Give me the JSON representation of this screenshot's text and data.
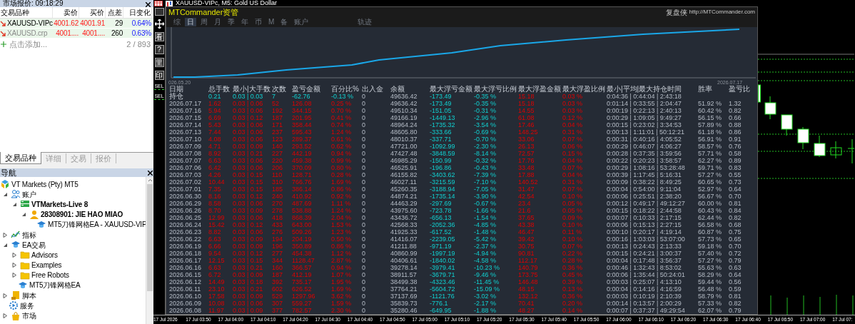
{
  "market_watch": {
    "title": "市场报价: 09:18:29",
    "columns": [
      "交易品种",
      "卖价",
      "买价",
      "点差",
      "日变化"
    ],
    "rows": [
      {
        "symbol": "XAUUSD-VIPc",
        "bid": "4001.62",
        "ask": "4001.91",
        "spread": "29",
        "change": "0.64%",
        "active": true
      },
      {
        "symbol": "XAUUSD.crp",
        "bid": "4001....",
        "ask": "4001....",
        "spread": "260",
        "change": "0.63%",
        "active": false
      }
    ],
    "add_label": "点击添加...",
    "count": "2 / 893",
    "tabs": [
      {
        "label": "交易品种",
        "selected": true
      },
      {
        "label": "详细",
        "selected": false
      },
      {
        "label": "交易",
        "selected": false
      },
      {
        "label": "报价",
        "selected": false
      }
    ]
  },
  "navigator": {
    "title": "导航",
    "items": [
      {
        "label": "VT Markets (Pty) MT5",
        "kind": "broker",
        "children": [
          {
            "label": "账户",
            "kind": "accounts",
            "expanded": true,
            "children": [
              {
                "label": "VTMarkets-Live 8",
                "kind": "server",
                "bold": true,
                "expanded": true,
                "children": [
                  {
                    "label": "28308901: JIE HAO MIAO",
                    "kind": "user",
                    "bold": true,
                    "expanded": true,
                    "children": [
                      {
                        "label": "MT5刀锋网格EA - XAUUSD-VIP",
                        "kind": "expert"
                      }
                    ]
                  }
                ]
              }
            ]
          },
          {
            "label": "指标",
            "kind": "indicators",
            "expanded": false
          },
          {
            "label": "EA交易",
            "kind": "expert",
            "expanded": true,
            "children": [
              {
                "label": "Advisors",
                "kind": "folder",
                "expanded": false
              },
              {
                "label": "Examples",
                "kind": "folder",
                "expanded": false
              },
              {
                "label": "Free Robots",
                "kind": "folder",
                "expanded": false
              },
              {
                "label": "MT5刀锋网格EA",
                "kind": "expert"
              }
            ]
          },
          {
            "label": "脚本",
            "kind": "script",
            "expanded": false
          },
          {
            "label": "服务",
            "kind": "service"
          },
          {
            "label": "市场",
            "kind": "market",
            "expanded": false
          }
        ]
      }
    ]
  },
  "chart_window": {
    "title": "XAUUSD-VIPc, M5:  Gold US Dollar",
    "toolbar": [
      {
        "kind": "minus"
      },
      {
        "kind": "move"
      },
      {
        "kind": "glyph",
        "label": "看"
      },
      {
        "kind": "glyph",
        "label": "?"
      },
      {
        "kind": "glyph",
        "label": "里"
      },
      {
        "kind": "glyph",
        "label": "印"
      }
    ],
    "order_labels": [
      "SEL",
      "SEL"
    ],
    "time_axis": [
      "17 Jul 2026",
      "17 Jul 03:50",
      "17 Jul 04:00",
      "17 Jul 04:10",
      "17 Jul 04:20",
      "17 Jul 04:30",
      "17 Jul 04:40",
      "17 Jul 04:50",
      "17 Jul 05:00",
      "17 Jul 05:10",
      "17 Jul 05:20",
      "17 Jul 05:30",
      "17 Jul 05:40",
      "17 Jul 05:50",
      "17 Jul 06:00",
      "17 Jul 06:10",
      "17 Jul 06:20",
      "17 Jul 06:30",
      "17 Jul 06:40",
      "17 Jul 06:50",
      "17 Jul 07:00",
      "17 Jul 07:"
    ]
  },
  "panel": {
    "title": "MTCommander资管",
    "brand": "复盘侠",
    "url": "http://MTCommander.com",
    "tabs": [
      {
        "label": "综",
        "selected": false
      },
      {
        "label": "日",
        "selected": true
      },
      {
        "label": "周",
        "selected": false
      },
      {
        "label": "月",
        "selected": false
      },
      {
        "label": "季",
        "selected": false
      },
      {
        "label": "年",
        "selected": false
      },
      {
        "label": "币",
        "selected": false
      },
      {
        "label": "M",
        "selected": false
      },
      {
        "label": "备",
        "selected": false
      },
      {
        "label": "账户",
        "selected": false
      },
      {
        "label": "轨迹",
        "selected": false
      }
    ],
    "equity_start": "026.05.20",
    "equity_end": "2026.07.17",
    "table": {
      "columns": [
        "日期",
        "总手数",
        "最小|大手数",
        "次数",
        "盈亏金额",
        "百分比%",
        "出入金",
        "余额",
        "最大浮亏金额",
        "最大浮亏比例",
        "最大浮盈金额",
        "最大浮盈比例",
        "最小|平均|最大持仓时间",
        "胜率",
        "盈亏比"
      ],
      "open_row": [
        "持仓",
        "0.21",
        "0.03 | 0.03",
        "7",
        "-62.76",
        "-0.13 %",
        "0",
        "49636.42",
        "-173.49",
        "-0.35 %",
        "15.18",
        "0.03 %",
        "0:04:36 | 0:44:04 | 2:43:18"
      ],
      "rows": [
        [
          "2026.07.17",
          "1.62",
          "0.03 | 0.06",
          "52",
          "126.08",
          "0.25 %",
          "0",
          "49636.42",
          "-173.49",
          "-0.35 %",
          "15.18",
          "0.03 %",
          "0:01:14 | 0:33:55 | 2:04:47",
          "51.92 %",
          "1.32"
        ],
        [
          "2026.07.16",
          "5.94",
          "0.03 | 0.06",
          "192",
          "344.15",
          "0.70 %",
          "0",
          "49510.34",
          "-151.05",
          "-0.31 %",
          "14.55",
          "0.03 %",
          "0:00:19 | 0:22:13 | 2:40:13",
          "60.42 %",
          "0.82"
        ],
        [
          "2026.07.15",
          "6.69",
          "0.03 | 0.12",
          "187",
          "201.95",
          "0.41 %",
          "0",
          "49166.19",
          "-1449.13",
          "-2.96 %",
          "61.08",
          "0.12 %",
          "0:00:29 | 1:09:05 | 9:49:27",
          "56.15 %",
          "0.66"
        ],
        [
          "2026.07.14",
          "5.43",
          "0.03 | 0.06",
          "171",
          "358.44",
          "0.74 %",
          "0",
          "48964.24",
          "-1735.32",
          "-3.54 %",
          "17.46",
          "0.04 %",
          "0:00:15 | 0:23:02 | 3:34:53",
          "57.89 %",
          "0.88"
        ],
        [
          "2026.07.13",
          "7.44",
          "0.03 | 0.06",
          "237",
          "595.43",
          "1.24 %",
          "0",
          "48605.80",
          "-333.66",
          "-0.69 %",
          "148.25",
          "0.31 %",
          "0:00:13 | 1:11:01 | 50:12:21",
          "61.18 %",
          "0.86"
        ],
        [
          "2026.07.10",
          "4.08",
          "0.03 | 0.06",
          "123",
          "289.37",
          "0.61 %",
          "0",
          "48010.37",
          "-337.71",
          "-0.70 %",
          "33.06",
          "0.07 %",
          "0:00:31 | 0:40:16 | 4:05:52",
          "56.91 %",
          "0.91"
        ],
        [
          "2026.07.09",
          "4.71",
          "0.03 | 0.09",
          "140",
          "293.52",
          "0.62 %",
          "0",
          "47721.00",
          "-1092.99",
          "-2.30 %",
          "26.13",
          "0.06 %",
          "0:00:29 | 0:46:07 | 4:06:27",
          "58.57 %",
          "0.76"
        ],
        [
          "2026.07.08",
          "8.92",
          "0.03 | 0.21",
          "227",
          "442.19",
          "0.94 %",
          "0",
          "47427.48",
          "-3848.59",
          "-8.14 %",
          "72.57",
          "0.15 %",
          "0:00:28 | 0:37:35 | 3:59:56",
          "57.71 %",
          "0.58"
        ],
        [
          "2026.07.07",
          "6.63",
          "0.03 | 0.06",
          "220",
          "459.38",
          "0.99 %",
          "0",
          "46985.29",
          "-150.99",
          "-0.32 %",
          "17.76",
          "0.04 %",
          "0:00:22 | 0:20:23 | 3:58:57",
          "62.27 %",
          "0.89"
        ],
        [
          "2026.07.06",
          "6.42",
          "0.03 | 0.06",
          "206",
          "370.09",
          "0.80 %",
          "0",
          "46525.91",
          "-196.86",
          "-0.43 %",
          "33.48",
          "0.07 %",
          "0:00:29 | 1:08:16 | 53:28:48",
          "59.71 %",
          "0.83"
        ],
        [
          "2026.07.03",
          "4.26",
          "0.03 | 0.15",
          "110",
          "128.71",
          "0.28 %",
          "0",
          "46155.82",
          "-3403.62",
          "-7.39 %",
          "17.88",
          "0.04 %",
          "0:00:39 | 1:17:45 | 5:16:31",
          "57.27 %",
          "0.55"
        ],
        [
          "2026.07.02",
          "10.44",
          "0.03 | 0.15",
          "310",
          "766.76",
          "1.69 %",
          "0",
          "46027.11",
          "-3215.59",
          "-7.10 %",
          "140.52",
          "0.31 %",
          "0:00:09 | 0:38:22 | 8:49:25",
          "60.65 %",
          "0.73"
        ],
        [
          "2026.07.01",
          "7.35",
          "0.03 | 0.15",
          "185",
          "386.14",
          "0.86 %",
          "0",
          "45260.35",
          "-3188.94",
          "-7.05 %",
          "31.47",
          "0.07 %",
          "0:00:04 | 0:54:00 | 9:11:04",
          "52.97 %",
          "0.64"
        ],
        [
          "2026.06.30",
          "8.16",
          "0.03 | 0.12",
          "240",
          "410.92",
          "0.92 %",
          "0",
          "44874.21",
          "-1735.14",
          "-3.90 %",
          "42.54",
          "0.10 %",
          "0:00:06 | 0:25:51 | 2:38:20",
          "56.67 %",
          "0.70"
        ],
        [
          "2026.06.29",
          "8.58",
          "0.03 | 0.06",
          "270",
          "487.69",
          "1.11 %",
          "0",
          "44463.29",
          "-297.69",
          "-0.67 %",
          "23.4",
          "0.05 %",
          "0:00:12 | 0:49:17 | 49:12:27",
          "60.00 %",
          "0.81"
        ],
        [
          "2026.06.26",
          "8.70",
          "0.03 | 0.09",
          "278",
          "538.88",
          "1.24 %",
          "0",
          "43975.60",
          "-723.78",
          "-1.66 %",
          "21.6",
          "0.05 %",
          "0:00:15 | 0:18:22 | 2:44:58",
          "60.43 %",
          "0.84"
        ],
        [
          "2026.06.25",
          "12.99",
          "0.03 | 0.06",
          "418",
          "868.39",
          "2.04 %",
          "0",
          "43436.72",
          "-656.13",
          "-1.54 %",
          "37.65",
          "0.09 %",
          "0:00:07 | 0:10:33 | 2:17:15",
          "62.44 %",
          "0.82"
        ],
        [
          "2026.06.24",
          "15.42",
          "0.03 | 0.12",
          "433",
          "643.00",
          "1.53 %",
          "0",
          "42568.33",
          "-2052.36",
          "-4.85 %",
          "43.38",
          "0.10 %",
          "0:00:06 | 0:15:13 | 2:27:15",
          "56.58 %",
          "0.68"
        ],
        [
          "2026.06.23",
          "8.82",
          "0.03 | 0.06",
          "276",
          "509.26",
          "1.23 %",
          "0",
          "41925.33",
          "-617.52",
          "-1.48 %",
          "46.47",
          "0.11 %",
          "0:00:10 | 0:20:17 | 4:19:14",
          "60.87 %",
          "0.75"
        ],
        [
          "2026.06.22",
          "6.63",
          "0.03 | 0.09",
          "194",
          "204.19",
          "0.50 %",
          "0",
          "41416.07",
          "-2239.05",
          "-5.42 %",
          "39.42",
          "0.10 %",
          "0:00:16 | 1:03:03 | 53:07:00",
          "57.73 %",
          "0.65"
        ],
        [
          "2026.06.19",
          "6.66",
          "0.03 | 0.09",
          "196",
          "350.89",
          "0.86 %",
          "0",
          "41211.88",
          "-971.19",
          "-2.37 %",
          "30.75",
          "0.07 %",
          "0:00:13 | 0:24:43 | 2:13:33",
          "59.18 %",
          "0.70"
        ],
        [
          "2026.06.18",
          "9.54",
          "0.03 | 0.12",
          "277",
          "454.38",
          "1.12 %",
          "0",
          "40860.99",
          "-1997.19",
          "-4.94 %",
          "90.81",
          "0.22 %",
          "0:00:15 | 0:24:21 | 3:00:37",
          "57.40 %",
          "0.72"
        ],
        [
          "2026.06.17",
          "12.15",
          "0.03 | 0.15",
          "344",
          "1128.47",
          "2.87 %",
          "0",
          "40406.61",
          "-1840.02",
          "-4.58 %",
          "112.17",
          "0.28 %",
          "0:00:04 | 0:17:48 | 3:56:37",
          "57.27 %",
          "0.79"
        ],
        [
          "2026.06.16",
          "6.63",
          "0.03 | 0.21",
          "160",
          "366.57",
          "0.94 %",
          "0",
          "39278.14",
          "-3979.41",
          "-10.23 %",
          "140.79",
          "0.36 %",
          "0:00:46 | 1:32:43 | 8:53:02",
          "55.63 %",
          "0.63"
        ],
        [
          "2026.06.15",
          "6.72",
          "0.03 | 0.09",
          "187",
          "412.19",
          "1.07 %",
          "0",
          "38911.57",
          "-3679.71",
          "-9.46 %",
          "173.75",
          "0.45 %",
          "0:00:06 | 1:35:44 | 50:24:01",
          "58.29 %",
          "0.64"
        ],
        [
          "2026.06.12",
          "14.49",
          "0.03 | 0.18",
          "392",
          "735.17",
          "1.95 %",
          "0",
          "38499.38",
          "-4323.46",
          "-11.45 %",
          "146.48",
          "0.39 %",
          "0:00:03 | 0:25:07 | 4:13:10",
          "59.44 %",
          "0.56"
        ],
        [
          "2026.06.11",
          "23.10",
          "0.03 | 0.21",
          "602",
          "626.52",
          "1.69 %",
          "0",
          "37764.21",
          "-5604.72",
          "-15.09 %",
          "48.15",
          "0.13 %",
          "0:00:04 | 0:14:16 | 4:16:59",
          "56.48 %",
          "0.59"
        ],
        [
          "2026.06.10",
          "17.58",
          "0.03 | 0.09",
          "529",
          "1297.96",
          "3.62 %",
          "0",
          "37137.69",
          "-1121.76",
          "-3.02 %",
          "132.12",
          "0.36 %",
          "0:00:03 | 0:10:19 | 2:10:39",
          "58.79 %",
          "0.81"
        ],
        [
          "2026.06.09",
          "10.08",
          "0.03 | 0.06",
          "307",
          "559.27",
          "1.59 %",
          "0",
          "35839.73",
          "-776.1",
          "-2.17 %",
          "70.41",
          "0.20 %",
          "0:00:14 | 0:13:57 | 2:00:29",
          "57.33 %",
          "0.82"
        ],
        [
          "2026.06.08",
          "11.97",
          "0.03 | 0.09",
          "377",
          "782.57",
          "2.30 %",
          "0",
          "35280.46",
          "-649.95",
          "-1.88 %",
          "48.27",
          "0.14 %",
          "0:00:07 | 0:37:37 | 49:29:54",
          "62.07 %",
          "0.79"
        ]
      ]
    }
  }
}
